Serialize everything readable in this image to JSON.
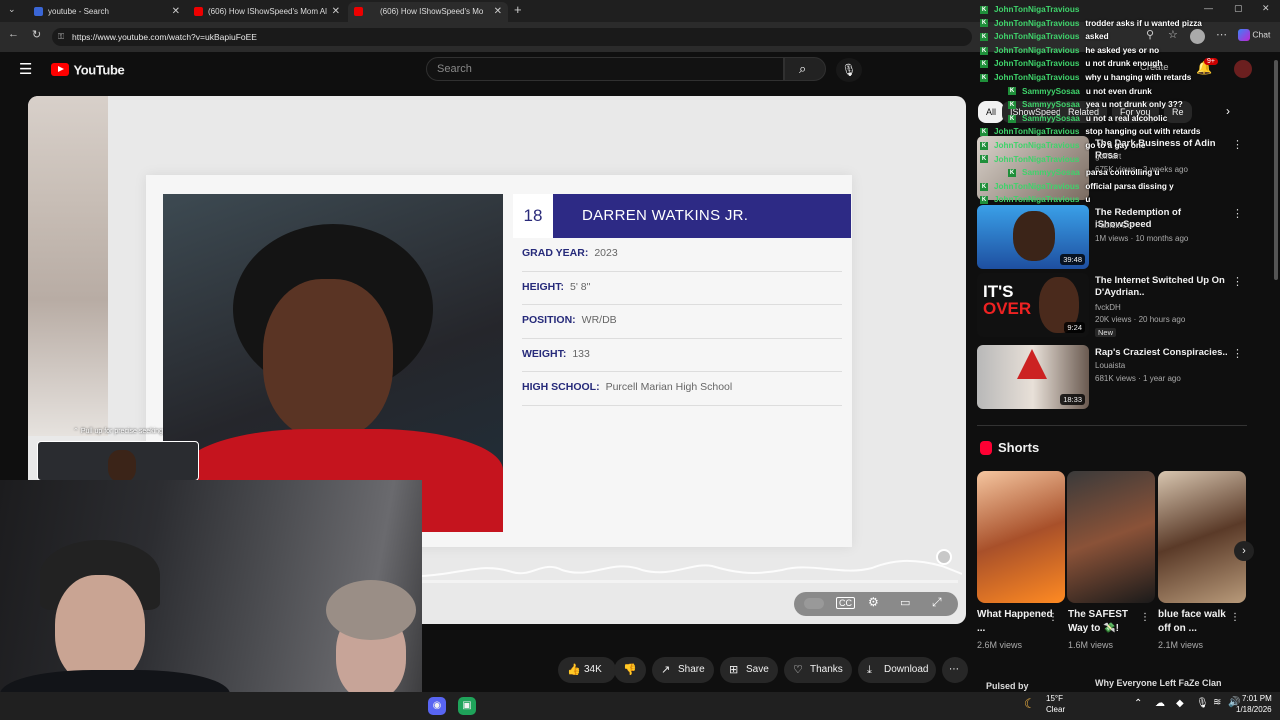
{
  "browser": {
    "tabs": [
      {
        "label": "youtube - Search",
        "active": false
      },
      {
        "label": "(606) How IShowSpeed's Mom Al",
        "active": false
      },
      {
        "label": "(606) How IShowSpeed's Mo",
        "active": true
      }
    ],
    "url": "https://www.youtube.com/watch?v=ukBapiuFoEE",
    "chat_button": "Chat"
  },
  "youtube": {
    "logo": "YouTube",
    "search_placeholder": "Search",
    "notif_count": "9+",
    "create_label": "Create"
  },
  "video_card": {
    "number": "18",
    "name": "DARREN WATKINS JR.",
    "fields": [
      {
        "label": "GRAD YEAR:",
        "value": "2023"
      },
      {
        "label": "HEIGHT:",
        "value": "5' 8\""
      },
      {
        "label": "POSITION:",
        "value": "WR/DB"
      },
      {
        "label": "WEIGHT:",
        "value": "133"
      },
      {
        "label": "HIGH SCHOOL:",
        "value": "Purcell Marian High School"
      }
    ],
    "seek_hint": "Pull up for precise seeking"
  },
  "actions": {
    "likes": "34K",
    "share": "Share",
    "save": "Save",
    "thanks": "Thanks",
    "download": "Download"
  },
  "sidebar": {
    "chips": [
      "All",
      "IShowSpeed",
      "Related",
      "For you",
      "Re"
    ],
    "videos": [
      {
        "title": "The Dark Business of Adin Ross",
        "channel": "golfcart",
        "meta": "675K views · 3 weeks ago",
        "duration": ""
      },
      {
        "title": "The Redemption of iShowSpeed",
        "channel": "Patrick Cc:",
        "meta": "1M views · 10 months ago",
        "duration": "39:48"
      },
      {
        "title": "The Internet Switched Up On D'Aydrian..",
        "channel": "fvckDH",
        "meta": "20K views · 20 hours ago",
        "badge": "New",
        "duration": "9:24"
      },
      {
        "title": "Rap's Craziest Conspiracies..",
        "channel": "Louaista",
        "meta": "681K views · 1 year ago",
        "duration": "18:33"
      }
    ],
    "shorts_title": "Shorts",
    "shorts": [
      {
        "title": "What Happened ...",
        "views": "2.6M views"
      },
      {
        "title": "The SAFEST Way to 💸!",
        "views": "1.6M views"
      },
      {
        "title": "blue face walk off on ...",
        "views": "2.1M views"
      }
    ],
    "next_left": "Pulsed by",
    "next_right": "Why Everyone Left FaZe Clan"
  },
  "chat": [
    {
      "user": "JohnTonNigaTravious",
      "msg": "",
      "indent": false
    },
    {
      "user": "JohnTonNigaTravious",
      "msg": "trodder asks if u wanted pizza",
      "indent": false
    },
    {
      "user": "JohnTonNigaTravious",
      "msg": "asked",
      "indent": false
    },
    {
      "user": "JohnTonNigaTravious",
      "msg": "he asked yes or no",
      "indent": false
    },
    {
      "user": "JohnTonNigaTravious",
      "msg": "u not drunk enough",
      "indent": false
    },
    {
      "user": "JohnTonNigaTravious",
      "msg": "why u hanging with retards",
      "indent": false
    },
    {
      "user": "SammyySosaa",
      "msg": "u not even drunk",
      "indent": true
    },
    {
      "user": "SammyySosaa",
      "msg": "yea u not drunk only 3??",
      "indent": true
    },
    {
      "user": "SammyySosaa",
      "msg": "u not a real alcoholic",
      "indent": true
    },
    {
      "user": "JohnTonNigaTravious",
      "msg": "stop hanging out with retards",
      "indent": false
    },
    {
      "user": "JohnTonNigaTravious",
      "msg": "go to a gay one",
      "indent": false
    },
    {
      "user": "JohnTonNigaTravious",
      "msg": "",
      "indent": false
    },
    {
      "user": "SammyySosaa",
      "msg": "parsa controlling u",
      "indent": true
    },
    {
      "user": "JohnTonNigaTravious",
      "msg": "official parsa dissing y",
      "indent": false
    },
    {
      "user": "JohnTonNigaTravious",
      "msg": "u",
      "indent": false
    }
  ],
  "taskbar": {
    "weather_temp": "15°F",
    "weather_desc": "Clear",
    "time": "7:01 PM",
    "date": "1/18/2026"
  },
  "colors": {
    "card_name_bg": "#2d2a85",
    "chat_user": "#3fd36b",
    "yt_red": "#ff0000"
  }
}
